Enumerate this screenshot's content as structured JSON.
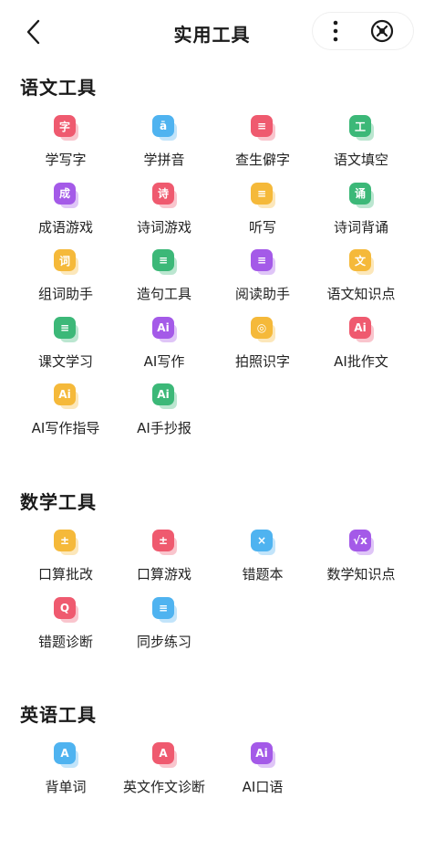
{
  "header": {
    "title": "实用工具",
    "back_icon": "chevron-left-icon",
    "more_icon": "more-vertical-icon",
    "close_icon": "close-circle-icon"
  },
  "sections": [
    {
      "title": "语文工具",
      "tools": [
        {
          "label": "学写字",
          "glyph": "字",
          "color": "#ef5a6f"
        },
        {
          "label": "学拼音",
          "glyph": "ā",
          "color": "#4fb3f0"
        },
        {
          "label": "查生僻字",
          "glyph": "≡",
          "color": "#ef5a6f"
        },
        {
          "label": "语文填空",
          "glyph": "工",
          "color": "#3cb878"
        },
        {
          "label": "成语游戏",
          "glyph": "成",
          "color": "#a45ae8"
        },
        {
          "label": "诗词游戏",
          "glyph": "诗",
          "color": "#ef5a6f"
        },
        {
          "label": "听写",
          "glyph": "≡",
          "color": "#f5b93a"
        },
        {
          "label": "诗词背诵",
          "glyph": "诵",
          "color": "#3cb878"
        },
        {
          "label": "组词助手",
          "glyph": "词",
          "color": "#f5b93a"
        },
        {
          "label": "造句工具",
          "glyph": "≡",
          "color": "#3cb878"
        },
        {
          "label": "阅读助手",
          "glyph": "≡",
          "color": "#a45ae8"
        },
        {
          "label": "语文知识点",
          "glyph": "文",
          "color": "#f5b93a"
        },
        {
          "label": "课文学习",
          "glyph": "≡",
          "color": "#3cb878"
        },
        {
          "label": "AI写作",
          "glyph": "Ai",
          "color": "#a45ae8"
        },
        {
          "label": "拍照识字",
          "glyph": "◎",
          "color": "#f5b93a"
        },
        {
          "label": "AI批作文",
          "glyph": "Ai",
          "color": "#ef5a6f"
        },
        {
          "label": "AI写作指导",
          "glyph": "Ai",
          "color": "#f5b93a"
        },
        {
          "label": "AI手抄报",
          "glyph": "Ai",
          "color": "#3cb878"
        }
      ]
    },
    {
      "title": "数学工具",
      "tools": [
        {
          "label": "口算批改",
          "glyph": "±",
          "color": "#f5b93a"
        },
        {
          "label": "口算游戏",
          "glyph": "±",
          "color": "#ef5a6f"
        },
        {
          "label": "错题本",
          "glyph": "×",
          "color": "#4fb3f0"
        },
        {
          "label": "数学知识点",
          "glyph": "√x",
          "color": "#a45ae8"
        },
        {
          "label": "错题诊断",
          "glyph": "Q",
          "color": "#ef5a6f"
        },
        {
          "label": "同步练习",
          "glyph": "≡",
          "color": "#4fb3f0"
        }
      ]
    },
    {
      "title": "英语工具",
      "tools": [
        {
          "label": "背单词",
          "glyph": "A",
          "color": "#4fb3f0"
        },
        {
          "label": "英文作文诊断",
          "glyph": "A",
          "color": "#ef5a6f"
        },
        {
          "label": "AI口语",
          "glyph": "Ai",
          "color": "#a45ae8"
        }
      ]
    }
  ]
}
